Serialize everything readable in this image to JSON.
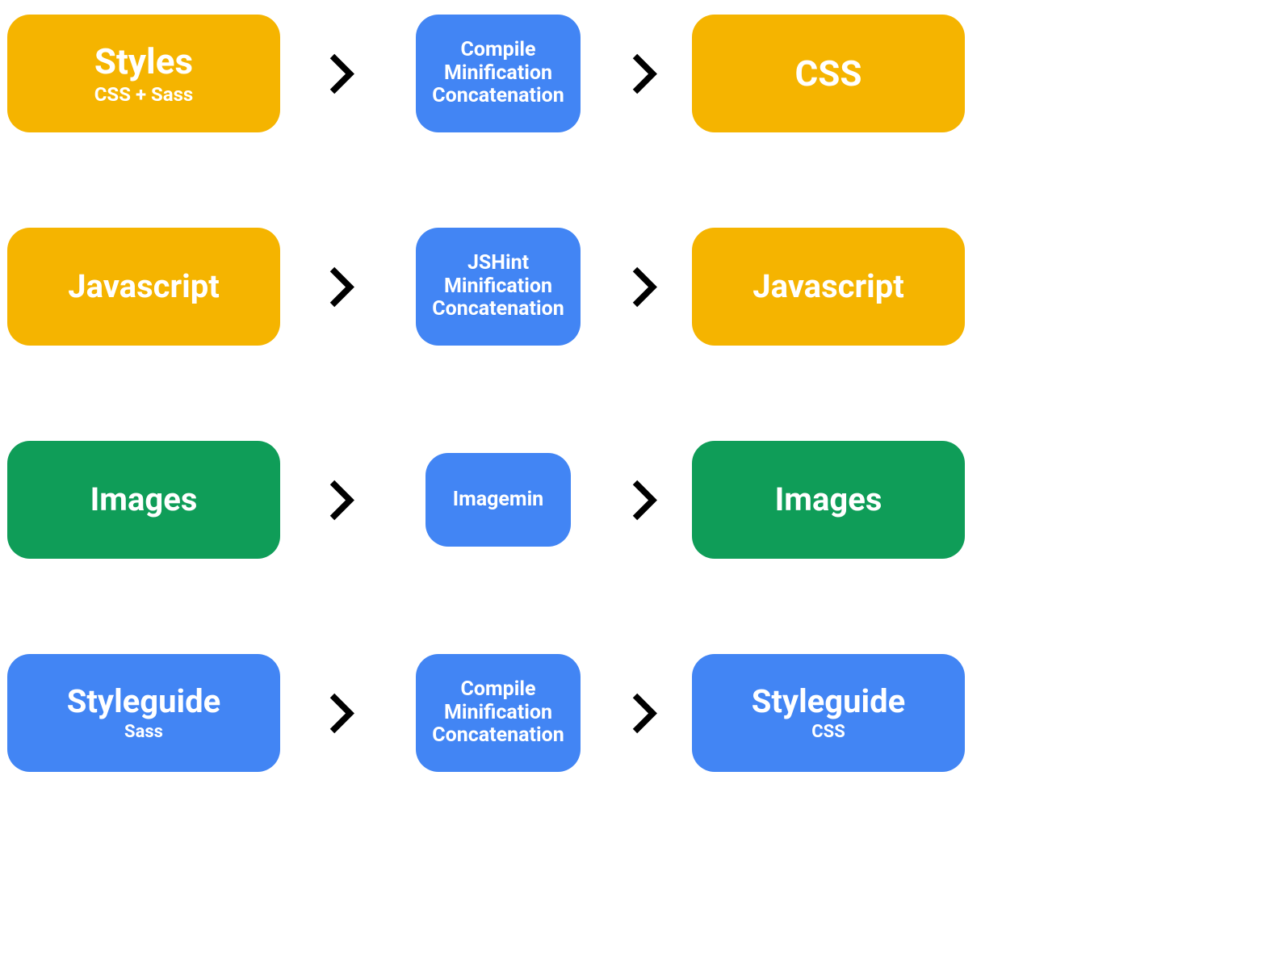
{
  "colors": {
    "yellow": "#f5b400",
    "blue": "#4285f4",
    "green": "#0f9d58"
  },
  "rows": [
    {
      "input": {
        "title": "Styles",
        "subtitle": "CSS + Sass",
        "color": "yellow",
        "title_class": "title-lg"
      },
      "process": {
        "lines": [
          "Compile",
          "Minification",
          "Concatenation"
        ],
        "color": "blue",
        "small": false
      },
      "output": {
        "title": "CSS",
        "subtitle": "",
        "color": "yellow",
        "title_class": "title-lg"
      }
    },
    {
      "input": {
        "title": "Javascript",
        "subtitle": "",
        "color": "yellow",
        "title_class": "title-md"
      },
      "process": {
        "lines": [
          "JSHint",
          "Minification",
          "Concatenation"
        ],
        "color": "blue",
        "small": false
      },
      "output": {
        "title": "Javascript",
        "subtitle": "",
        "color": "yellow",
        "title_class": "title-md"
      }
    },
    {
      "input": {
        "title": "Images",
        "subtitle": "",
        "color": "green",
        "title_class": "title-md"
      },
      "process": {
        "lines": [
          "Imagemin"
        ],
        "color": "blue",
        "small": true
      },
      "output": {
        "title": "Images",
        "subtitle": "",
        "color": "green",
        "title_class": "title-md"
      }
    },
    {
      "input": {
        "title": "Styleguide",
        "subtitle": "Sass",
        "color": "blue",
        "title_class": "title-md"
      },
      "process": {
        "lines": [
          "Compile",
          "Minification",
          "Concatenation"
        ],
        "color": "blue",
        "small": false
      },
      "output": {
        "title": "Styleguide",
        "subtitle": "CSS",
        "color": "blue",
        "title_class": "title-md"
      }
    }
  ]
}
